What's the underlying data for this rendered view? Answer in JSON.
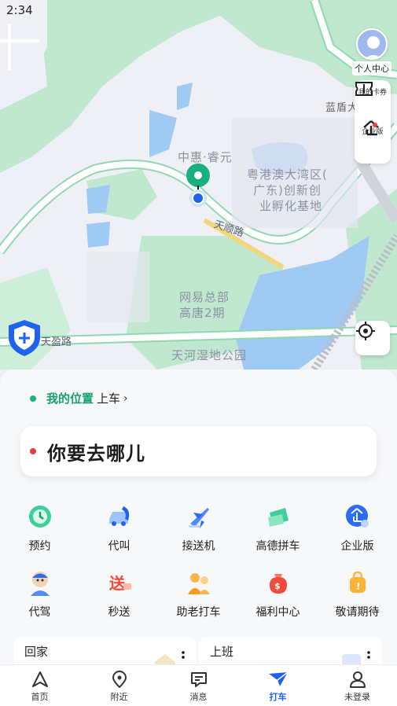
{
  "status_bar": {
    "time": "2:34"
  },
  "map": {
    "place_labels": [
      "中惠·睿元",
      "粤港澳大湾区(",
      "广东)创新创",
      "业孵化基地",
      "网易总部",
      "高唐2期",
      "天河湿地公园",
      "蓝盾大"
    ],
    "road_labels": [
      "天顺路",
      "天盈路"
    ]
  },
  "right_controls": {
    "profile_label": "个人中心",
    "coupon_label": "我的卡券",
    "enterprise_label": "企业版"
  },
  "pickup": {
    "location": "我的位置",
    "suffix": "上车",
    "chevron": "›"
  },
  "destination": {
    "placeholder": "你要去哪儿"
  },
  "services": [
    {
      "label": "预约",
      "icon": "clock-icon"
    },
    {
      "label": "代叫",
      "icon": "car-phone-icon"
    },
    {
      "label": "接送机",
      "icon": "airplane-icon"
    },
    {
      "label": "高德拼车",
      "icon": "carpool-icon"
    },
    {
      "label": "企业版",
      "icon": "enterprise-icon"
    },
    {
      "label": "代驾",
      "icon": "driver-icon"
    },
    {
      "label": "秒送",
      "icon": "delivery-icon"
    },
    {
      "label": "助老打车",
      "icon": "elder-icon"
    },
    {
      "label": "福利中心",
      "icon": "gift-bag-icon"
    },
    {
      "label": "敬请期待",
      "icon": "bag-icon"
    }
  ],
  "shortcuts": {
    "home": "回家",
    "work": "上班"
  },
  "tabbar": [
    {
      "label": "首页",
      "icon": "navigation-arrow-icon"
    },
    {
      "label": "附近",
      "icon": "location-pin-icon"
    },
    {
      "label": "消息",
      "icon": "message-icon"
    },
    {
      "label": "打车",
      "icon": "taxi-icon",
      "active": true
    },
    {
      "label": "未登录",
      "icon": "user-icon"
    }
  ],
  "colors": {
    "accent": "#1f62f0",
    "green": "#15a06f",
    "red": "#ef3b43"
  }
}
